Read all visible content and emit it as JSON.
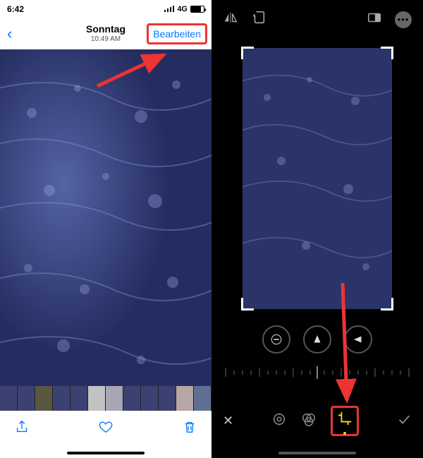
{
  "left": {
    "status": {
      "time": "6:42",
      "net": "4G"
    },
    "nav": {
      "day": "Sonntag",
      "subtitle": "10:49 AM",
      "edit": "Bearbeiten"
    }
  },
  "right": {
    "toolbar": {
      "flip": "flip-icon",
      "rotate": "rotate-icon",
      "aspect": "aspect-icon",
      "more": "more-icon"
    }
  }
}
